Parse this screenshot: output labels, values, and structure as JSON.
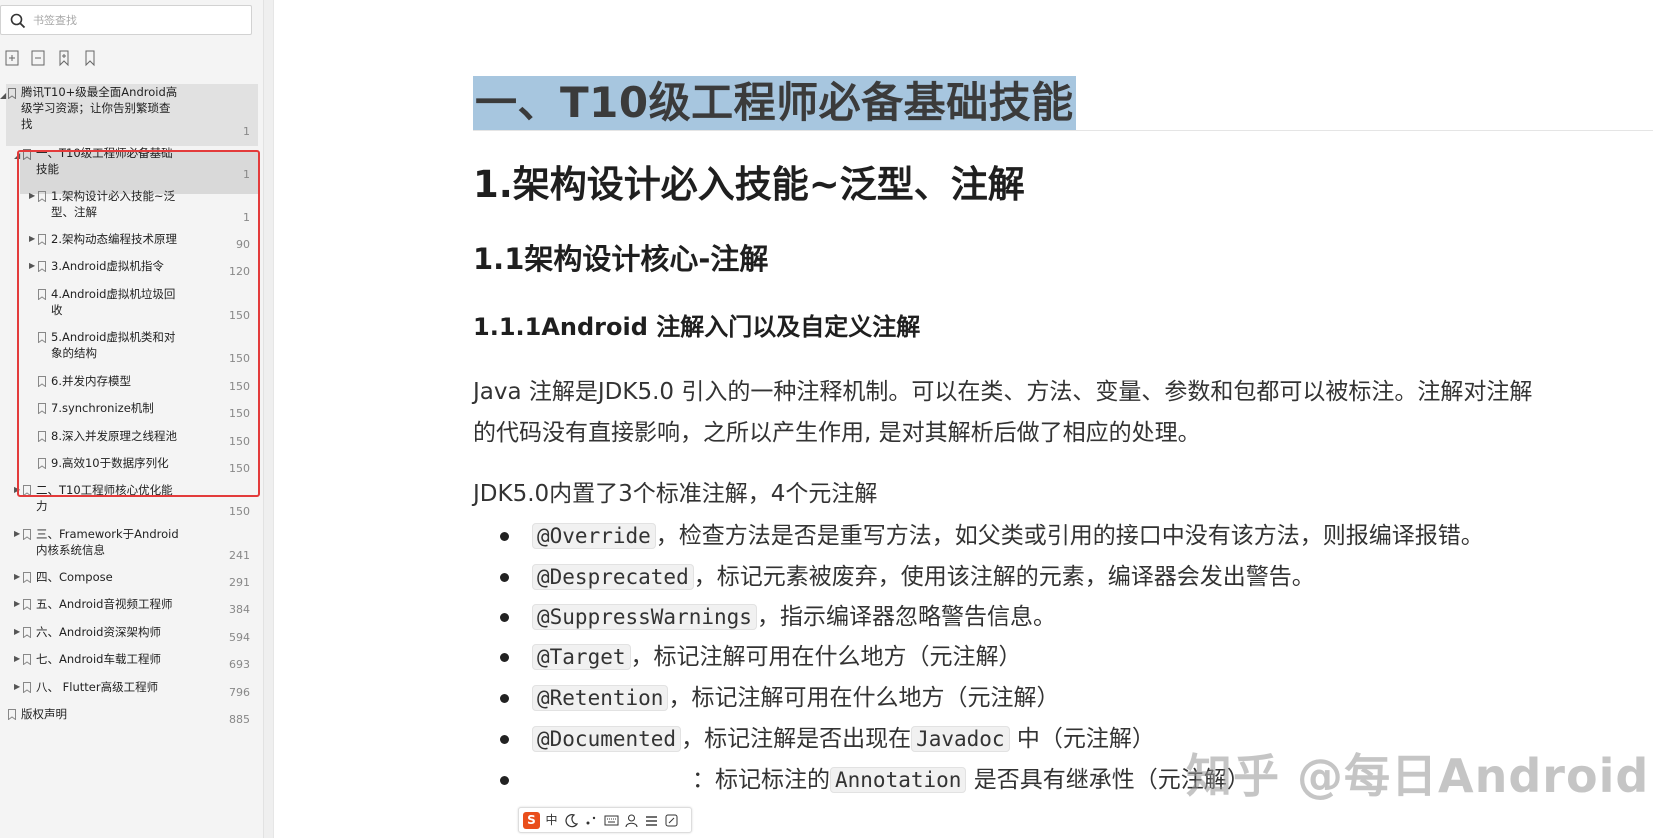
{
  "sidebar": {
    "search_placeholder": "书签查找",
    "toolbar_icons": [
      "expand-all-icon",
      "collapse-all-icon",
      "add-bookmark-icon",
      "bookmark-icon"
    ],
    "tree": [
      {
        "label": "腾讯T10+级最全面Android高级学习资源；让你告别繁琐查找",
        "page": "1"
      },
      {
        "label": "一、T10级工程师必备基础技能",
        "page": "1"
      },
      {
        "label": "1.架构设计必入技能~泛型、注解",
        "page": "1"
      },
      {
        "label": "2.架构动态编程技术原理",
        "page": "90"
      },
      {
        "label": "3.Android虚拟机指令",
        "page": "120"
      },
      {
        "label": "4.Android虚拟机垃圾回收",
        "page": "150"
      },
      {
        "label": "5.Android虚拟机类和对象的结构",
        "page": "150"
      },
      {
        "label": "6.并发内存模型",
        "page": "150"
      },
      {
        "label": "7.synchronize机制",
        "page": "150"
      },
      {
        "label": "8.深入并发原理之线程池",
        "page": "150"
      },
      {
        "label": "9.高效10于数据序列化",
        "page": "150"
      },
      {
        "label": "二、T10工程师核心优化能力",
        "page": "150"
      },
      {
        "label": "三、Framework于Android内核系统信息",
        "page": "241"
      },
      {
        "label": "四、Compose",
        "page": "291"
      },
      {
        "label": "五、Android音视频工程师",
        "page": "384"
      },
      {
        "label": "六、Android资深架构师",
        "page": "594"
      },
      {
        "label": "七、Android车载工程师",
        "page": "693"
      },
      {
        "label": "八、 Flutter高级工程师",
        "page": "796"
      },
      {
        "label": "版权声明",
        "page": "885"
      }
    ]
  },
  "document": {
    "h1": "一、T10级工程师必备基础技能",
    "h2": "1.架构设计必入技能~泛型、注解",
    "h3": "1.1架构设计核心-注解",
    "h4": "1.1.1Android 注解入门以及自定义注解",
    "p1_line1": "Java 注解是JDK5.0 引入的一种注释机制。可以在类、方法、变量、参数和包都可以被标注。注解对注解",
    "p1_line2": "的代码没有直接影响，之所以产生作用, 是对其解析后做了相应的处理。",
    "p2": "JDK5.0内置了3个标准注解，4个元注解",
    "bullets": [
      {
        "code": "@Override",
        "text": "，检查方法是否是重写方法，如父类或引用的接口中没有该方法，则报编译报错。"
      },
      {
        "code": "@Desprecated",
        "text": "，标记元素被废弃，使用该注解的元素，编译器会发出警告。"
      },
      {
        "code": "@SuppressWarnings",
        "text": "，指示编译器忽略警告信息。"
      },
      {
        "code": "@Target",
        "text": "，标记注解可用在什么地方（元注解）"
      },
      {
        "code": "@Retention",
        "text": "，标记注解可用在什么地方（元注解）"
      },
      {
        "code": "@Documented",
        "text": "，标记注解是否出现在",
        "code2": "Javadoc",
        "text2": " 中（元注解）"
      },
      {
        "code": "",
        "text": "：标记标注的",
        "code2": "Annotation",
        "text2": " 是否具有继承性（元注解）"
      }
    ],
    "watermark": "知乎 @每日Android"
  },
  "ime_toolbar": {
    "logo": "S",
    "mode": "中",
    "icons": [
      "moon-icon",
      "punctuation-icon",
      "keyboard-icon",
      "user-icon",
      "menu-icon",
      "tools-icon"
    ]
  },
  "colors": {
    "heading_highlight": "#a7c6df",
    "selection_border": "#e33b3b",
    "ime_logo": "#e94e1b"
  }
}
